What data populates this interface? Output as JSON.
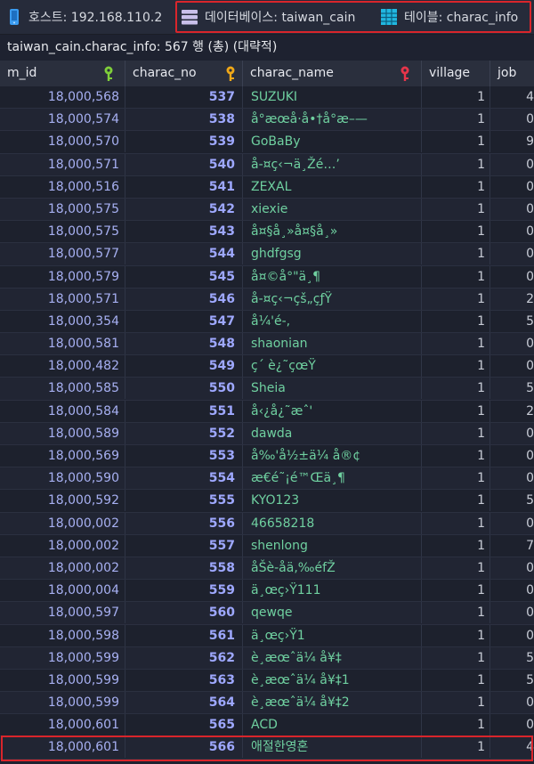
{
  "topbar": {
    "host": "호스트: 192.168.110.2",
    "database": "데이터베이스: taiwan_cain",
    "table": "테이블: charac_info"
  },
  "caption": "taiwan_cain.charac_info: 567 행 (총) (대략적)",
  "columns": [
    "m_id",
    "charac_no",
    "charac_name",
    "village",
    "job"
  ],
  "rows": [
    {
      "m_id": "18,000,568",
      "charac_no": "537",
      "charac_name": "SUZUKI",
      "village": "1",
      "job": "4"
    },
    {
      "m_id": "18,000,574",
      "charac_no": "538",
      "charac_name": "å°æœå·å•†å°æ–—",
      "village": "1",
      "job": "0"
    },
    {
      "m_id": "18,000,570",
      "charac_no": "539",
      "charac_name": "GoBaBy",
      "village": "1",
      "job": "9"
    },
    {
      "m_id": "18,000,571",
      "charac_no": "540",
      "charac_name": "å-¤ç‹¬ä¸Žé…’",
      "village": "1",
      "job": "0"
    },
    {
      "m_id": "18,000,516",
      "charac_no": "541",
      "charac_name": "ZEXAL",
      "village": "1",
      "job": "0"
    },
    {
      "m_id": "18,000,575",
      "charac_no": "542",
      "charac_name": "xiexie",
      "village": "1",
      "job": "0"
    },
    {
      "m_id": "18,000,575",
      "charac_no": "543",
      "charac_name": "å¤§å¸»å¤§å¸»",
      "village": "1",
      "job": "0"
    },
    {
      "m_id": "18,000,577",
      "charac_no": "544",
      "charac_name": "ghdfgsg",
      "village": "1",
      "job": "0"
    },
    {
      "m_id": "18,000,579",
      "charac_no": "545",
      "charac_name": "å¤©å°\"ä¸¶",
      "village": "1",
      "job": "0"
    },
    {
      "m_id": "18,000,571",
      "charac_no": "546",
      "charac_name": "å-¤ç‹¬çš„çƒŸ",
      "village": "1",
      "job": "2"
    },
    {
      "m_id": "18,000,354",
      "charac_no": "547",
      "charac_name": "å¼'é-,",
      "village": "1",
      "job": "5"
    },
    {
      "m_id": "18,000,581",
      "charac_no": "548",
      "charac_name": "shaonian",
      "village": "1",
      "job": "0"
    },
    {
      "m_id": "18,000,482",
      "charac_no": "549",
      "charac_name": "ç´ è¿˜çœŸ",
      "village": "1",
      "job": "0"
    },
    {
      "m_id": "18,000,585",
      "charac_no": "550",
      "charac_name": "Sheia",
      "village": "1",
      "job": "5"
    },
    {
      "m_id": "18,000,584",
      "charac_no": "551",
      "charac_name": "å‹¿å¿˜æˆ'",
      "village": "1",
      "job": "2"
    },
    {
      "m_id": "18,000,589",
      "charac_no": "552",
      "charac_name": "dawda",
      "village": "1",
      "job": "0"
    },
    {
      "m_id": "18,000,569",
      "charac_no": "553",
      "charac_name": "å‰'å½±ä¼ å®¢",
      "village": "1",
      "job": "0"
    },
    {
      "m_id": "18,000,590",
      "charac_no": "554",
      "charac_name": "æ€é˜¡é™Œä¸¶",
      "village": "1",
      "job": "0"
    },
    {
      "m_id": "18,000,592",
      "charac_no": "555",
      "charac_name": "KYO123",
      "village": "1",
      "job": "5"
    },
    {
      "m_id": "18,000,002",
      "charac_no": "556",
      "charac_name": "46658218",
      "village": "1",
      "job": "0"
    },
    {
      "m_id": "18,000,002",
      "charac_no": "557",
      "charac_name": "shenlong",
      "village": "1",
      "job": "7"
    },
    {
      "m_id": "18,000,002",
      "charac_no": "558",
      "charac_name": "åŠè-åä‚‰éfŽ",
      "village": "1",
      "job": "0"
    },
    {
      "m_id": "18,000,004",
      "charac_no": "559",
      "charac_name": "ä¸œç›Ÿ111",
      "village": "1",
      "job": "0"
    },
    {
      "m_id": "18,000,597",
      "charac_no": "560",
      "charac_name": "qewqe",
      "village": "1",
      "job": "0"
    },
    {
      "m_id": "18,000,598",
      "charac_no": "561",
      "charac_name": "ä¸œç›Ÿ1",
      "village": "1",
      "job": "0"
    },
    {
      "m_id": "18,000,599",
      "charac_no": "562",
      "charac_name": "è¸æœˆä¼ å¥‡",
      "village": "1",
      "job": "5"
    },
    {
      "m_id": "18,000,599",
      "charac_no": "563",
      "charac_name": "è¸æœˆä¼ å¥‡1",
      "village": "1",
      "job": "5"
    },
    {
      "m_id": "18,000,599",
      "charac_no": "564",
      "charac_name": "è¸æœˆä¼ å¥‡2",
      "village": "1",
      "job": "0"
    },
    {
      "m_id": "18,000,601",
      "charac_no": "565",
      "charac_name": "ACD",
      "village": "1",
      "job": "0"
    },
    {
      "m_id": "18,000,601",
      "charac_no": "566",
      "charac_name": "애절한영혼",
      "village": "1",
      "job": "4"
    }
  ],
  "colors": {
    "background": "#1e2230",
    "highlight": "#d9252b",
    "name_text": "#6fd0a0",
    "number_text": "#9ea8ff"
  }
}
